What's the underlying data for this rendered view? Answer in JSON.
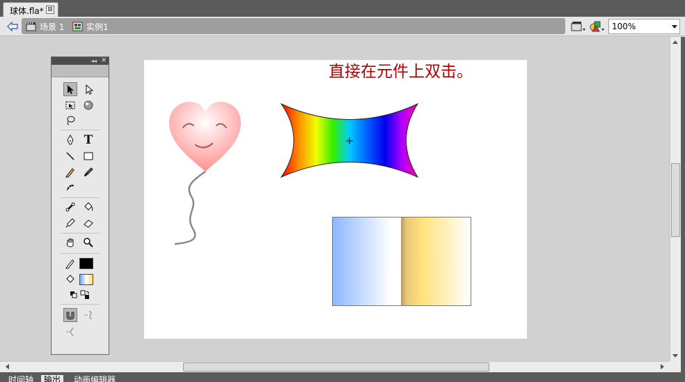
{
  "document_tab": {
    "title": "球体.fla*",
    "close_glyph": "⊠"
  },
  "edit_bar": {
    "scene_label": "场景 1",
    "symbol_label": "实例1",
    "zoom_value": "100%"
  },
  "stage": {
    "instruction_text": "直接在元件上双击。",
    "colors": {
      "text": "#b10000",
      "stage_bg": "#ffffff"
    }
  },
  "tools": {
    "text_tool_glyph": "T",
    "stroke_color": "#000000",
    "fill_colors": [
      "#ffe066",
      "#6ea8ff"
    ]
  },
  "bottom_tabs": [
    {
      "label": "时间轴"
    },
    {
      "label": "输出"
    },
    {
      "label": "动画编辑器"
    }
  ]
}
